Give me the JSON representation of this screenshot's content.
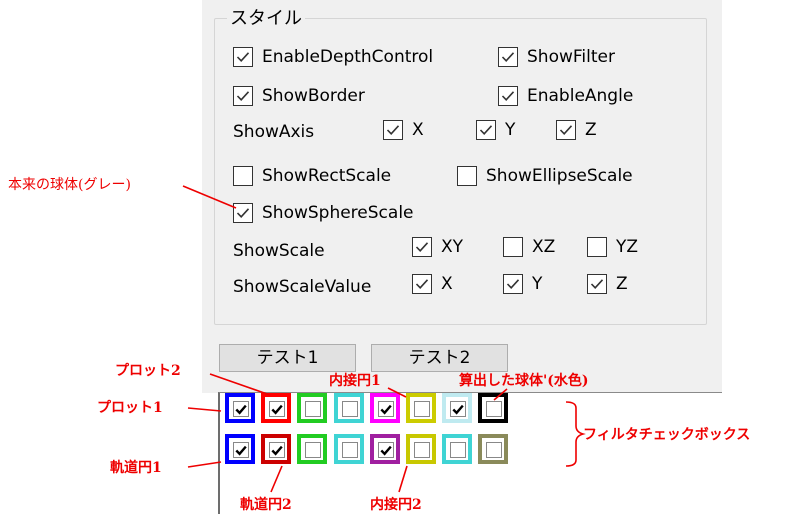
{
  "group": {
    "title": "スタイル"
  },
  "checkboxes": {
    "enable_depth": {
      "label": "EnableDepthControl",
      "checked": true
    },
    "show_filter": {
      "label": "ShowFilter",
      "checked": true
    },
    "show_border": {
      "label": "ShowBorder",
      "checked": true
    },
    "enable_angle": {
      "label": "EnableAngle",
      "checked": true
    },
    "axis_x": {
      "label": "X",
      "checked": true
    },
    "axis_y": {
      "label": "Y",
      "checked": true
    },
    "axis_z": {
      "label": "Z",
      "checked": true
    },
    "rect_scale": {
      "label": "ShowRectScale",
      "checked": false
    },
    "ellipse_scale": {
      "label": "ShowEllipseScale",
      "checked": false
    },
    "sphere_scale": {
      "label": "ShowSphereScale",
      "checked": true
    },
    "scale_xy": {
      "label": "XY",
      "checked": true
    },
    "scale_xz": {
      "label": "XZ",
      "checked": false
    },
    "scale_yz": {
      "label": "YZ",
      "checked": false
    },
    "value_x": {
      "label": "X",
      "checked": true
    },
    "value_y": {
      "label": "Y",
      "checked": true
    },
    "value_z": {
      "label": "Z",
      "checked": true
    }
  },
  "labels": {
    "show_axis": "ShowAxis",
    "show_scale": "ShowScale",
    "show_scale_value": "ShowScaleValue"
  },
  "buttons": {
    "test1": "テスト1",
    "test2": "テスト2"
  },
  "filter_boxes": {
    "top": [
      {
        "color": "#0000ff",
        "checked": true
      },
      {
        "color": "#ff0000",
        "checked": true
      },
      {
        "color": "#22cc22",
        "checked": false
      },
      {
        "color": "#3fd4d4",
        "checked": false
      },
      {
        "color": "#ff00ff",
        "checked": true
      },
      {
        "color": "#cccc00",
        "checked": false
      },
      {
        "color": "#bfeaf0",
        "checked": true
      },
      {
        "color": "#000000",
        "checked": false
      }
    ],
    "bottom": [
      {
        "color": "#0000ff",
        "checked": true
      },
      {
        "color": "#cc0000",
        "checked": true
      },
      {
        "color": "#22cc22",
        "checked": false
      },
      {
        "color": "#3fd4d4",
        "checked": false
      },
      {
        "color": "#a020a0",
        "checked": true
      },
      {
        "color": "#c8c800",
        "checked": false
      },
      {
        "color": "#3fd4d4",
        "checked": false
      },
      {
        "color": "#8a8a5a",
        "checked": false
      }
    ]
  },
  "annotations": {
    "grey_sphere": "本来の球体(グレー)",
    "plot2": "プロット2",
    "plot1": "プロット1",
    "incircle1": "内接円1",
    "computed_sphere": "算出した球体'(水色)",
    "filter_checkboxes": "フィルタチェックボックス",
    "orbit1": "軌道円1",
    "orbit2": "軌道円2",
    "incircle2": "内接円2"
  },
  "colors": {
    "annotation": "#ee0000",
    "panel": "#f0f0f0"
  }
}
